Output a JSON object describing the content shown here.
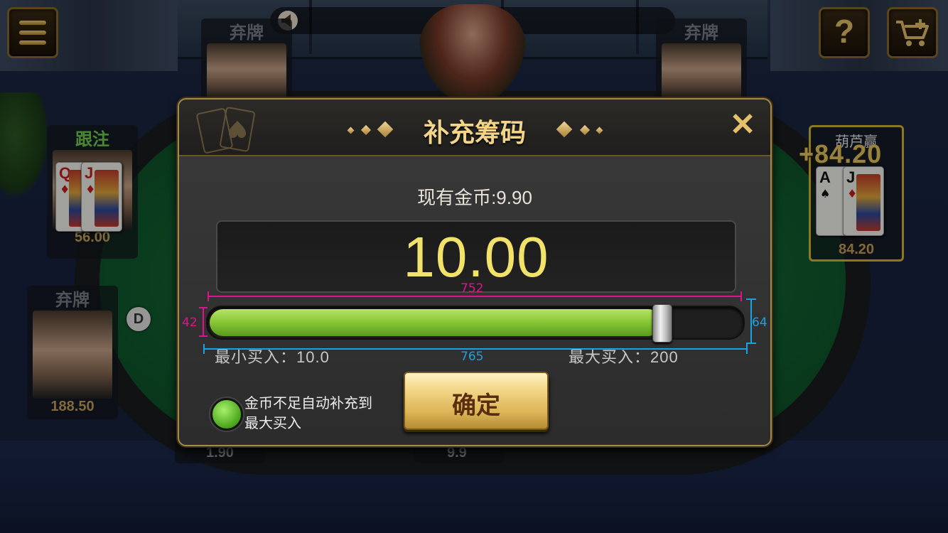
{
  "topbar": {
    "menu_icon": "menu-icon",
    "help_label": "?",
    "cart_icon": "cart-add-icon",
    "speaker_icon": "speaker-icon"
  },
  "seats": {
    "top_left": {
      "status": "弃牌"
    },
    "top_right": {
      "status": "弃牌"
    },
    "left_upper": {
      "status": "跟注",
      "chips": "56.00",
      "cards": [
        {
          "rank": "Q",
          "suit": "♦"
        },
        {
          "rank": "J",
          "suit": "♦"
        }
      ]
    },
    "left_lower": {
      "status": "弃牌",
      "chips": "188.50"
    },
    "right": {
      "name": "葫芦赢",
      "win": "+84.20",
      "chips": "84.20",
      "cards": [
        {
          "rank": "A",
          "suit": "♠"
        },
        {
          "rank": "J",
          "suit": "♦"
        }
      ]
    },
    "bottom_left": {
      "chips": "1.90"
    },
    "bottom_center": {
      "chips": "9.9"
    }
  },
  "dealer_button": "D",
  "dialog": {
    "title": "补充筹码",
    "close_label": "✕",
    "balance": "现有金币:9.90",
    "amount": "10.00",
    "slider_level": 0.85,
    "min_label": "最小买入：10.0",
    "max_label": "最大买入：200",
    "auto_refill_text": "金币不足自动补充到最大买入",
    "confirm_label": "确定",
    "annotations": {
      "width_top": "752",
      "width_bottom": "765",
      "height_left": "42",
      "height_right": "64"
    }
  },
  "colors": {
    "accent_gold": "#f3d58a",
    "slider_green": "#8ac838",
    "amount_yellow": "#f2e269"
  }
}
